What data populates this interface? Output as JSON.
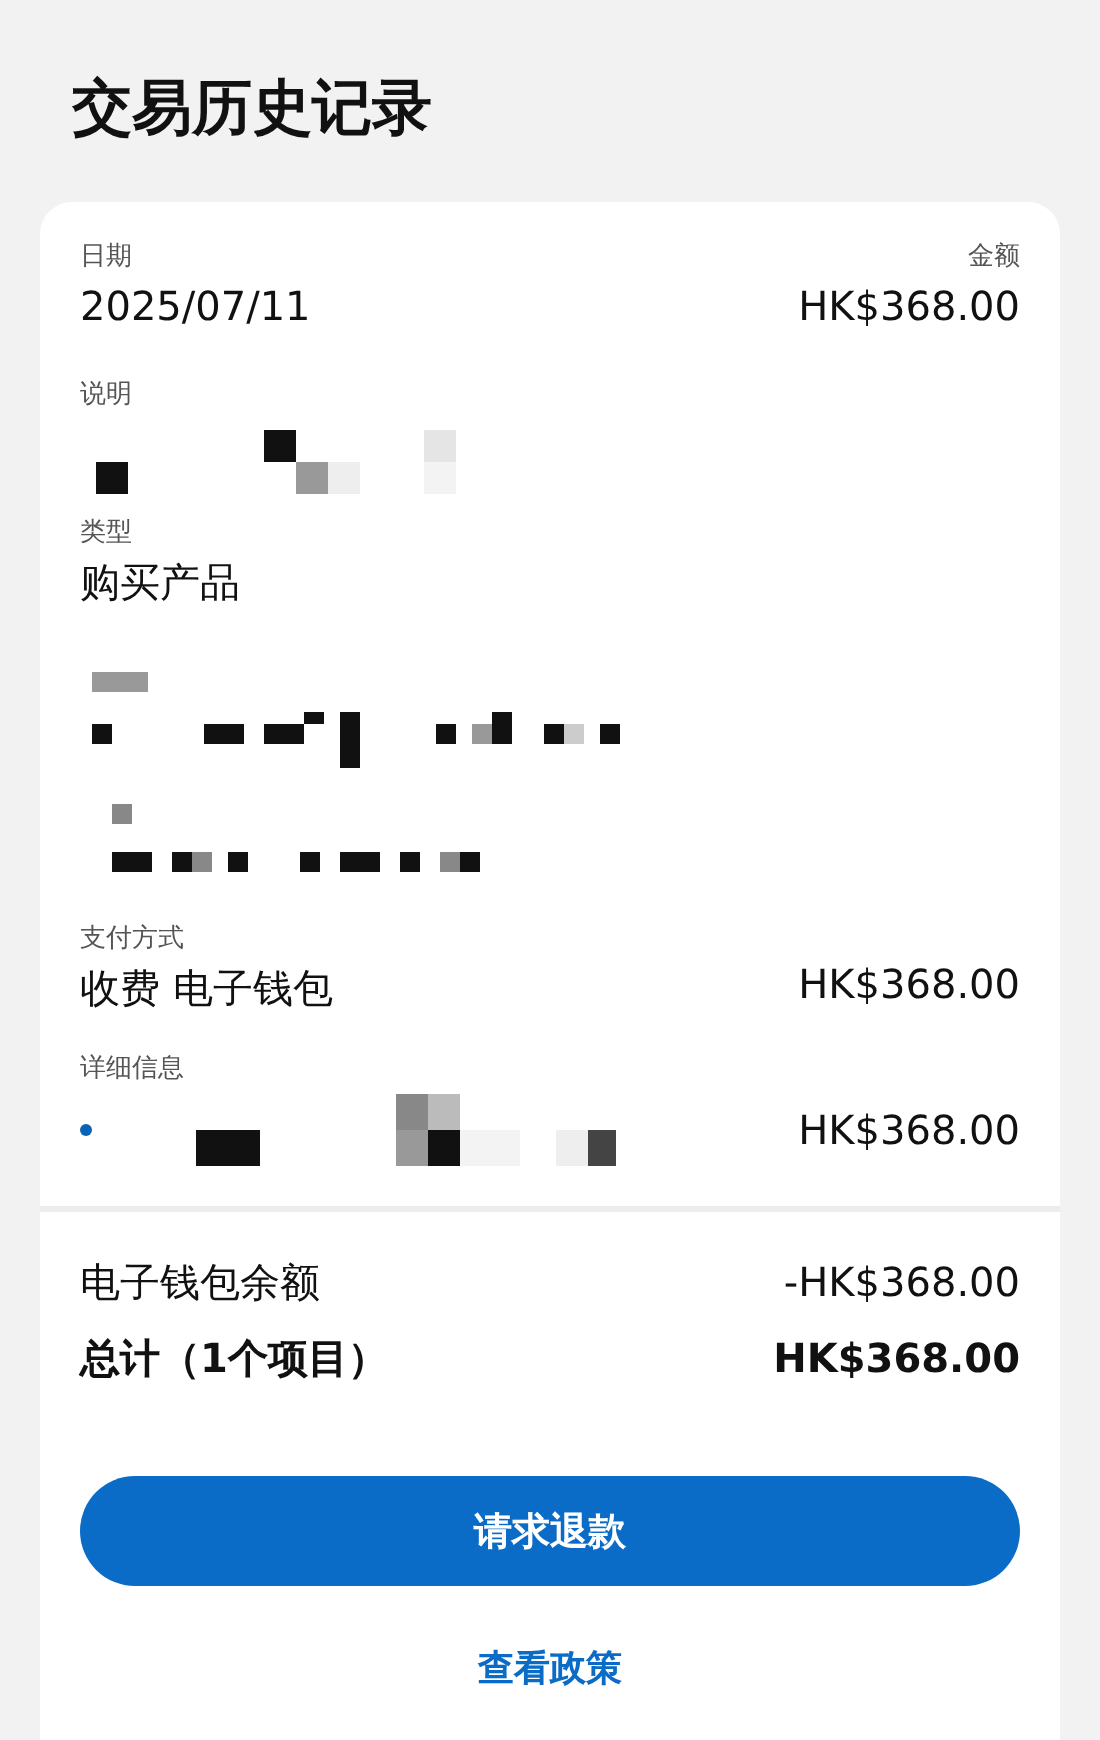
{
  "title": "交易历史记录",
  "date": {
    "label": "日期",
    "value": "2025/07/11"
  },
  "amount": {
    "label": "金额",
    "value": "HK$368.00"
  },
  "description": {
    "label": "说明"
  },
  "type": {
    "label": "类型",
    "value": "购买产品"
  },
  "payment": {
    "label": "支付方式",
    "value": "收费 电子钱包",
    "amount": "HK$368.00"
  },
  "details": {
    "label": "详细信息",
    "items": [
      {
        "amount": "HK$368.00"
      }
    ]
  },
  "summary": [
    {
      "kind": "line",
      "label": "电子钱包余额",
      "value": "-HK$368.00"
    },
    {
      "kind": "total",
      "label": "总计（1个项目）",
      "value": "HK$368.00"
    }
  ],
  "refund_button": "请求退款",
  "policy_link": "查看政策"
}
